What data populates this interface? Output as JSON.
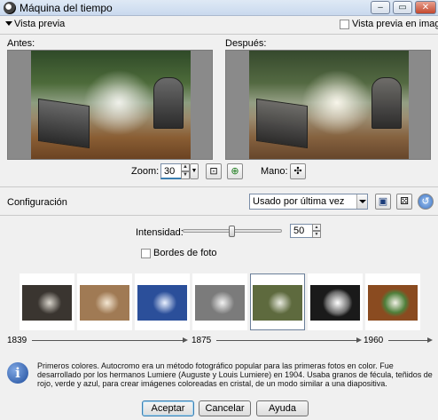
{
  "window": {
    "title": "Máquina del tiempo",
    "controls": [
      "minimize-icon",
      "maximize-icon",
      "close-icon"
    ]
  },
  "preview": {
    "toggle_label": "Vista previa",
    "in_image_label": "Vista previa en imagen",
    "in_image_checked": false,
    "before_label": "Antes:",
    "after_label": "Después:"
  },
  "zoom": {
    "label": "Zoom:",
    "value": "30",
    "hand_label": "Mano:"
  },
  "configuration": {
    "label": "Configuración",
    "preset_value": "Usado por última vez"
  },
  "intensity": {
    "label": "Intensidad:",
    "value": "50",
    "level": 0.5
  },
  "photo_borders": {
    "label": "Bordes de foto",
    "checked": false
  },
  "eras": {
    "selected_index": 4,
    "items": [
      {
        "name": "era-1839",
        "tone": "#3a3530"
      },
      {
        "name": "era-sepia",
        "tone": "#a07a54"
      },
      {
        "name": "era-cyanotype",
        "tone": "#2b4f9a"
      },
      {
        "name": "era-bw",
        "tone": "#7b7b7b"
      },
      {
        "name": "era-autochrome",
        "tone": "#5e6a3e"
      },
      {
        "name": "era-bw-contrast",
        "tone": "#6c6c6c"
      },
      {
        "name": "era-color",
        "tone": "#4f7f3a"
      }
    ],
    "timeline": [
      "1839",
      "1875",
      "1960"
    ]
  },
  "info": {
    "text": "Primeros colores. Autocromo era un método fotográfico popular para las primeras fotos en color. Fue desarrollado por los hermanos Lumiere (Auguste y Louis Lumiere) en 1904. Usaba granos de fécula, teñidos de rojo, verde y azul, para crear imágenes coloreadas en cristal, de un modo similar a una diapositiva."
  },
  "buttons": {
    "accept": "Aceptar",
    "cancel": "Cancelar",
    "help": "Ayuda"
  },
  "colors": {
    "window_bg": "#f0f0f0",
    "selection_border": "#6b7f99",
    "info_icon": "#1f4d9c"
  }
}
